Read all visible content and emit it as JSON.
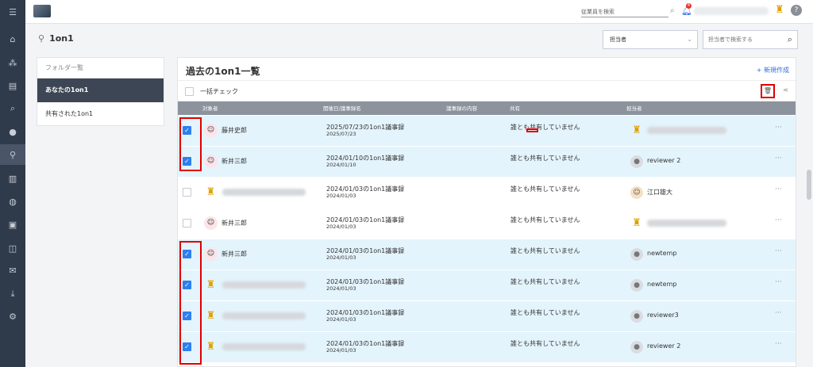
{
  "header": {
    "employee_search_placeholder": "従業員を検索",
    "notification_count": "4",
    "help_label": "?"
  },
  "page": {
    "title": "1on1",
    "owner_filter_label": "担当者",
    "owner_search_placeholder": "担当者で検索する"
  },
  "folders": {
    "header": "フォルダ一覧",
    "items": [
      {
        "label": "あなたの1on1",
        "active": true
      },
      {
        "label": "共有された1on1",
        "active": false
      }
    ]
  },
  "list": {
    "title": "過去の1on1一覧",
    "new_label": "+ 新規作成",
    "bulk_check_label": "一括チェック",
    "columns": {
      "target": "対象者",
      "date": "開催日/議事録名",
      "content": "議事録の内容",
      "sharing": "共有",
      "owner": "担当者"
    }
  },
  "rows": [
    {
      "checked": true,
      "target": "藤井史郎",
      "target_blurred": false,
      "title": "2025/07/23の1on1議事録",
      "date": "2025/07/23",
      "sharing": "誰とも共有していません",
      "owner": "",
      "owner_blurred": true
    },
    {
      "checked": true,
      "target": "新井三郎",
      "target_blurred": false,
      "title": "2024/01/10の1on1議事録",
      "date": "2024/01/10",
      "sharing": "誰とも共有していません",
      "owner": "reviewer 2",
      "owner_blurred": false
    },
    {
      "checked": false,
      "target": "",
      "target_blurred": true,
      "title": "2024/01/03の1on1議事録",
      "date": "2024/01/03",
      "sharing": "誰とも共有していません",
      "owner": "江口雄大",
      "owner_blurred": false
    },
    {
      "checked": false,
      "target": "新井三郎",
      "target_blurred": false,
      "title": "2024/01/03の1on1議事録",
      "date": "2024/01/03",
      "sharing": "誰とも共有していません",
      "owner": "",
      "owner_blurred": true
    },
    {
      "checked": true,
      "target": "新井三郎",
      "target_blurred": false,
      "title": "2024/01/03の1on1議事録",
      "date": "2024/01/03",
      "sharing": "誰とも共有していません",
      "owner": "newtemp",
      "owner_blurred": false
    },
    {
      "checked": true,
      "target": "",
      "target_blurred": true,
      "title": "2024/01/03の1on1議事録",
      "date": "2024/01/03",
      "sharing": "誰とも共有していません",
      "owner": "newtemp",
      "owner_blurred": false
    },
    {
      "checked": true,
      "target": "",
      "target_blurred": true,
      "title": "2024/01/03の1on1議事録",
      "date": "2024/01/03",
      "sharing": "誰とも共有していません",
      "owner": "reviewer3",
      "owner_blurred": false
    },
    {
      "checked": true,
      "target": "",
      "target_blurred": true,
      "title": "2024/01/03の1on1議事録",
      "date": "2024/01/03",
      "sharing": "誰とも共有していません",
      "owner": "reviewer 2",
      "owner_blurred": false
    }
  ],
  "icons": {
    "nav": [
      "menu-icon",
      "home-icon",
      "org-icon",
      "document-icon",
      "search-icon",
      "chat-icon",
      "link-icon",
      "chart-icon",
      "globe-icon",
      "id-card-icon",
      "book-icon",
      "mail-icon",
      "download-icon",
      "user-settings-icon"
    ]
  },
  "colors": {
    "accent": "#2d7ff0",
    "nav_bg": "#2f3a4a",
    "highlight": "#e00000",
    "selected_row": "#e4f4fc"
  }
}
